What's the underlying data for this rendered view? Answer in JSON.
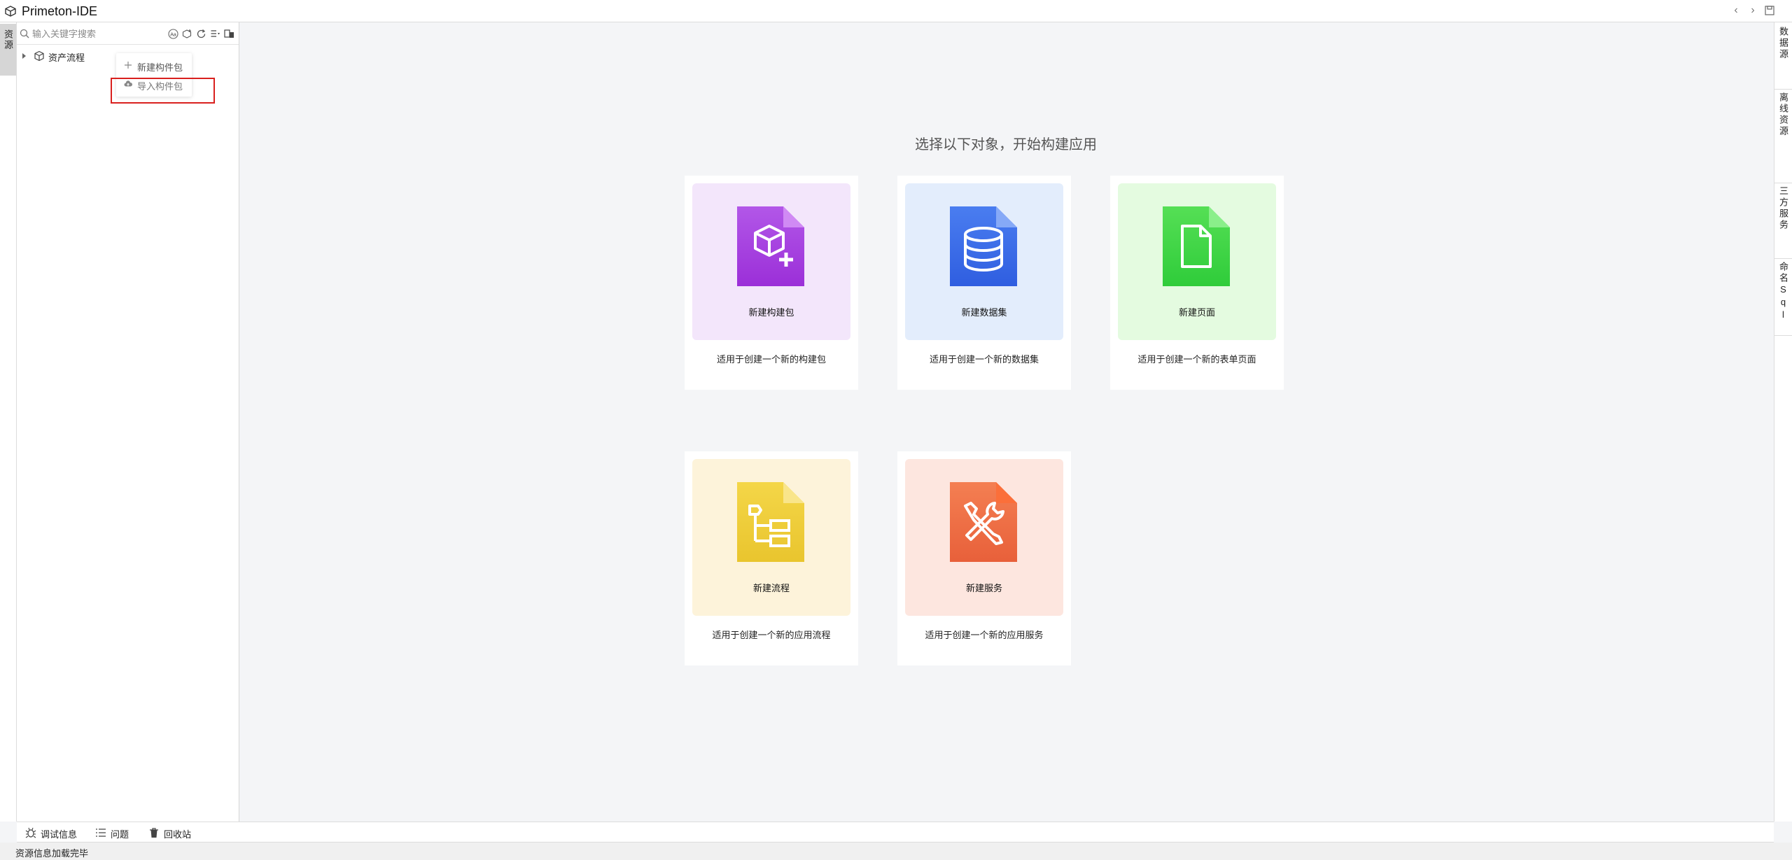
{
  "app": {
    "title": "Primeton-IDE"
  },
  "left_strip": {
    "resource_tab": "资源"
  },
  "resource_panel": {
    "search_placeholder": "输入关键字搜索",
    "tree": [
      {
        "label": "资产流程"
      }
    ]
  },
  "context_menu": {
    "items": [
      {
        "label": "新建构件包"
      },
      {
        "label": "导入构件包"
      }
    ]
  },
  "main": {
    "heading": "选择以下对象，开始构建应用",
    "cards": [
      {
        "title": "新建构建包",
        "desc": "适用于创建一个新的构建包",
        "tile_color": "#f3e6fb",
        "icon": "package-plus-icon"
      },
      {
        "title": "新建数据集",
        "desc": "适用于创建一个新的数据集",
        "tile_color": "#e3edfc",
        "icon": "database-icon"
      },
      {
        "title": "新建页面",
        "desc": "适用于创建一个新的表单页面",
        "tile_color": "#e4fbe0",
        "icon": "page-icon"
      },
      {
        "title": "新建流程",
        "desc": "适用于创建一个新的应用流程",
        "tile_color": "#fdf3da",
        "icon": "flow-icon"
      },
      {
        "title": "新建服务",
        "desc": "适用于创建一个新的应用服务",
        "tile_color": "#fde6df",
        "icon": "tools-icon"
      }
    ]
  },
  "right_strip": {
    "tabs": [
      {
        "label": "数据源"
      },
      {
        "label": "离线资源"
      },
      {
        "label": "三方服务"
      },
      {
        "label": "命名Sql"
      }
    ]
  },
  "bottom_bar": {
    "tabs": [
      {
        "label": "调试信息"
      },
      {
        "label": "问题"
      },
      {
        "label": "回收站"
      }
    ]
  },
  "status": {
    "text": "资源信息加载完毕"
  }
}
